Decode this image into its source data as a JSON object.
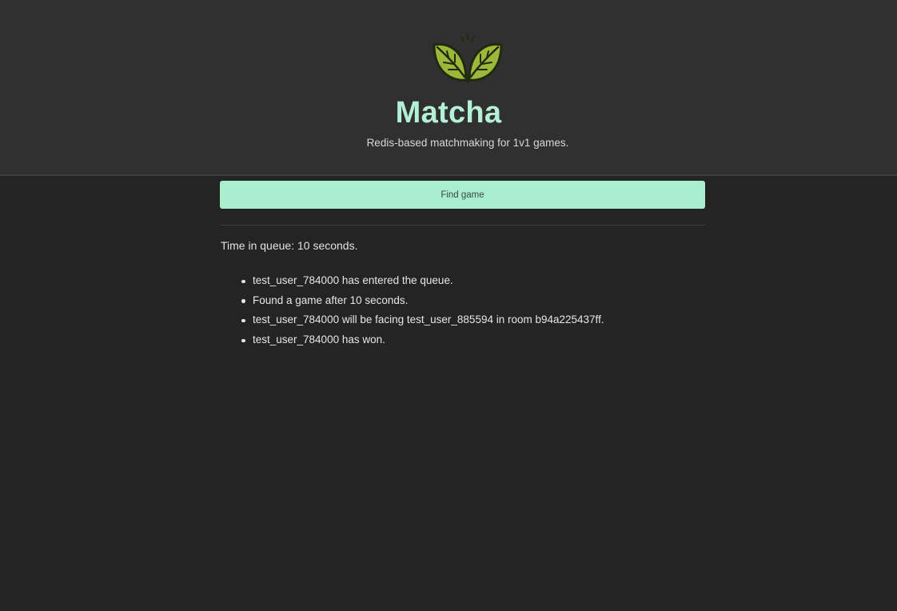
{
  "app": {
    "title": "Matcha",
    "subtitle": "Redis-based matchmaking for 1v1 games."
  },
  "logo": {
    "icon": "tea-leaves-icon",
    "leaf_color": "#9bb83a",
    "outline_color": "#1f2a10"
  },
  "colors": {
    "title": "#b4f0d6",
    "button_bg": "#aaeed0",
    "header_bg": "#303030",
    "page_bg": "#242424"
  },
  "actions": {
    "find_game_label": "Find game"
  },
  "queue": {
    "status_text": "Time in queue: 10 seconds."
  },
  "log": {
    "entries": [
      "test_user_784000 has entered the queue.",
      "Found a game after 10 seconds.",
      "test_user_784000 will be facing test_user_885594 in room b94a225437ff.",
      "test_user_784000 has won."
    ]
  }
}
